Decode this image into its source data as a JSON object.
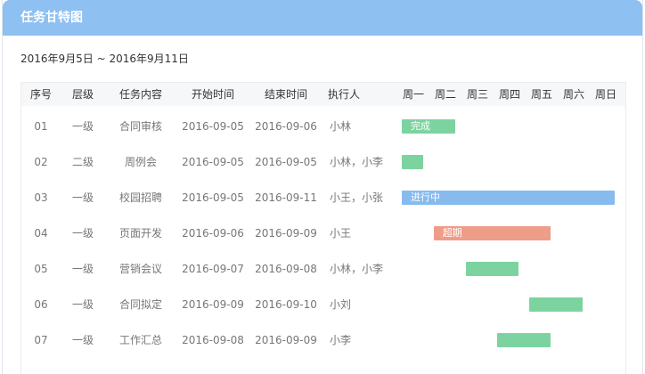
{
  "header": {
    "title": "任务甘特图"
  },
  "date_range": "2016年9月5日 ~ 2016年9月11日",
  "columns": {
    "index": "序号",
    "level": "层级",
    "task": "任务内容",
    "start": "开始时间",
    "end": "结束时间",
    "owner": "执行人"
  },
  "weekdays": [
    "周一",
    "周二",
    "周三",
    "周四",
    "周五",
    "周六",
    "周日"
  ],
  "colors": {
    "header": "#8ec0f2",
    "done": "#7dd3a0",
    "in_progress": "#87bbee",
    "overdue": "#ee9d89",
    "normal": "#7dd3a0"
  },
  "rows": [
    {
      "index": "01",
      "level": "一级",
      "task": "合同审核",
      "start": "2016-09-05",
      "end": "2016-09-06",
      "owner": "小林",
      "bar_label": "完成",
      "status": "done"
    },
    {
      "index": "02",
      "level": "二级",
      "task": "周例会",
      "start": "2016-09-05",
      "end": "2016-09-05",
      "owner": "小林，小李",
      "bar_label": "",
      "status": "normal"
    },
    {
      "index": "03",
      "level": "一级",
      "task": "校园招聘",
      "start": "2016-09-05",
      "end": "2016-09-11",
      "owner": "小王，小张",
      "bar_label": "进行中",
      "status": "in_progress"
    },
    {
      "index": "04",
      "level": "一级",
      "task": "页面开发",
      "start": "2016-09-06",
      "end": "2016-09-09",
      "owner": "小王",
      "bar_label": "超期",
      "status": "overdue"
    },
    {
      "index": "05",
      "level": "一级",
      "task": "营销会议",
      "start": "2016-09-07",
      "end": "2016-09-08",
      "owner": "小林，小李",
      "bar_label": "",
      "status": "normal"
    },
    {
      "index": "06",
      "level": "一级",
      "task": "合同拟定",
      "start": "2016-09-09",
      "end": "2016-09-10",
      "owner": "小刘",
      "bar_label": "",
      "status": "normal"
    },
    {
      "index": "07",
      "level": "一级",
      "task": "工作汇总",
      "start": "2016-09-08",
      "end": "2016-09-09",
      "owner": "小李",
      "bar_label": "",
      "status": "normal"
    }
  ]
}
